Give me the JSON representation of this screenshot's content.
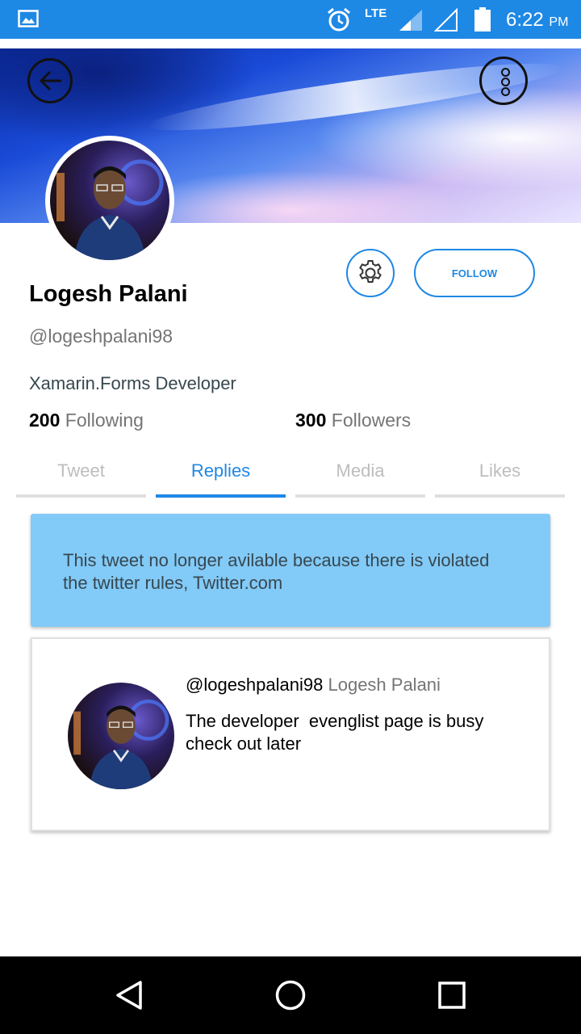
{
  "status_bar": {
    "network": "LTE",
    "time": "6:22",
    "ampm": "PM",
    "icons": [
      "image-icon",
      "alarm-icon",
      "signal-icon",
      "signal-empty-icon",
      "battery-icon"
    ]
  },
  "colors": {
    "accent": "#1E88E5",
    "notice_bg": "#82CAF7",
    "status_bar": "#1E88E5"
  },
  "header": {
    "back_icon": "arrow-left-icon",
    "more_icon": "more-vertical-icon"
  },
  "profile": {
    "name": "Logesh Palani",
    "handle": "@logeshpalani98",
    "bio": "Xamarin.Forms Developer",
    "following_count": "200",
    "following_label": "Following",
    "followers_count": "300",
    "followers_label": "Followers",
    "follow_label": "FOLLOW",
    "settings_icon": "gear-icon"
  },
  "tabs": [
    {
      "label": "Tweet",
      "active": false
    },
    {
      "label": "Replies",
      "active": true
    },
    {
      "label": "Media",
      "active": false
    },
    {
      "label": "Likes",
      "active": false
    }
  ],
  "notice": {
    "text": "This tweet no longer avilable because there is violated the twitter rules, Twitter.com"
  },
  "tweet": {
    "handle": "@logeshpalani98",
    "author": "Logesh Palani",
    "text": "The developer  evenglist page is busy check out later"
  },
  "nav_bar": {
    "icons": [
      "back-triangle-icon",
      "home-circle-icon",
      "recents-square-icon"
    ]
  }
}
